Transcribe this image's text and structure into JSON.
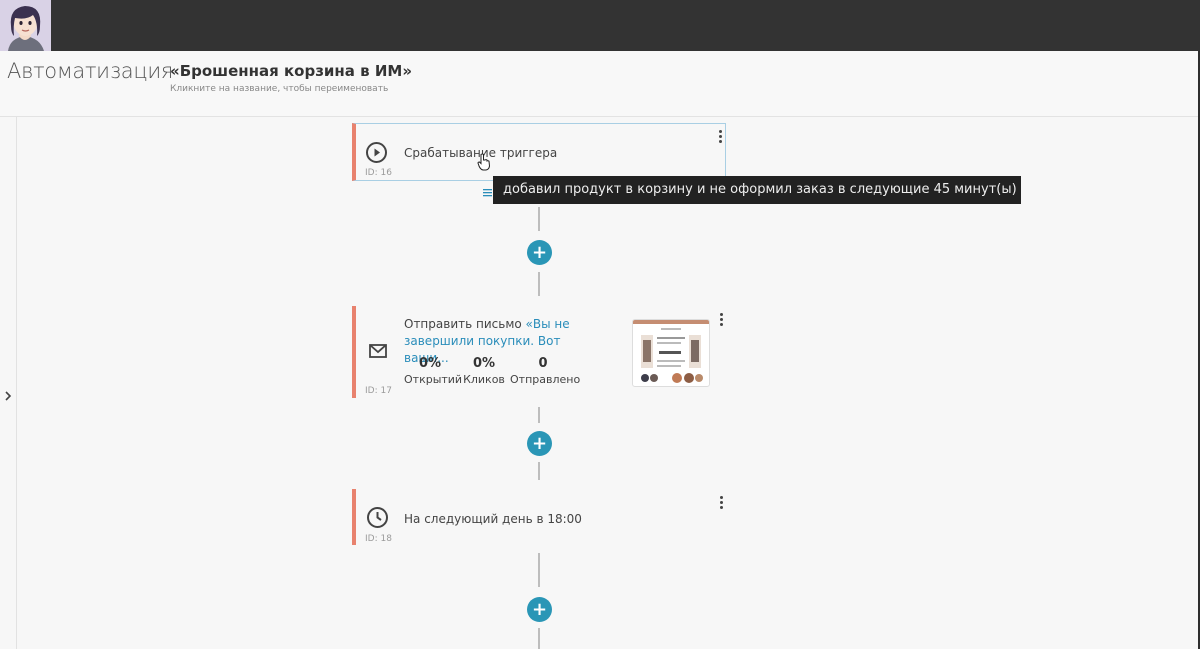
{
  "header": {
    "section_title": "Автоматизация",
    "flow_name": "«Брошенная корзина в ИМ»",
    "flow_hint": "Кликните на название, чтобы переименовать"
  },
  "nodes": {
    "trigger": {
      "label": "Срабатывание триггера",
      "id_text": "ID: 16",
      "tooltip": "добавил продукт в корзину и не оформил заказ в следующие 45 минут(ы)"
    },
    "email": {
      "action": "Отправить письмо",
      "subject": "«Вы не завершили покупки. Вот ваши...",
      "id_text": "ID: 17",
      "stats": [
        {
          "value": "0%",
          "label": "Открытий"
        },
        {
          "value": "0%",
          "label": "Кликов"
        },
        {
          "value": "0",
          "label": "Отправлено"
        }
      ]
    },
    "delay": {
      "label": "На следующий день в 18:00",
      "id_text": "ID: 18"
    }
  },
  "add_step_label": "+",
  "colors": {
    "accent_bar": "#e8826e",
    "plus_button": "#2a96b6",
    "link": "#2a8dba",
    "topbar": "#333333"
  },
  "icons": {
    "trigger": "play-circle-icon",
    "email": "envelope-icon",
    "delay": "clock-icon",
    "menu": "kebab-menu-icon",
    "expand": "chevron-right-icon",
    "details": "list-lines-icon"
  }
}
